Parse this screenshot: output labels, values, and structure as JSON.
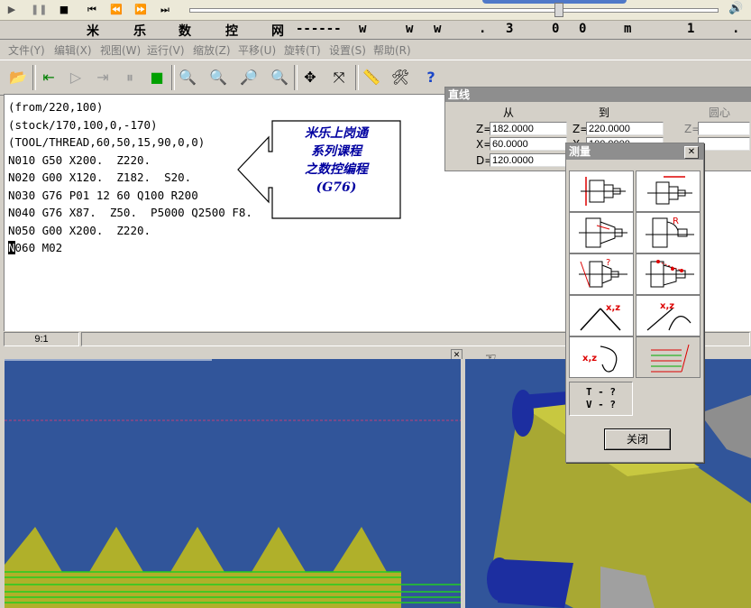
{
  "title_band": [
    "米",
    "乐",
    "数",
    "控",
    "网",
    "------",
    "w",
    "w",
    "w",
    ".",
    "3",
    "0",
    "0",
    "m",
    "1",
    "."
  ],
  "menu": [
    "文件(Y)",
    "编辑(X)",
    "视图(W)",
    "运行(V)",
    "缩放(Z)",
    "平移(U)",
    "旋转(T)",
    "设置(S)",
    "帮助(R)"
  ],
  "code_lines": [
    "(from/220,100)",
    "(stock/170,100,0,-170)",
    "(TOOL/THREAD,60,50,15,90,0,0)",
    "N010 G50 X200.  Z220.",
    "N020 G00 X120.  Z182.  S20.",
    "N030 G76 P01 12 60 Q100 R200",
    "N040 G76 X87.  Z50.  P5000 Q2500 F8.",
    "N050 G00 X200.  Z220."
  ],
  "code_last": {
    "cursor": "N",
    "rest": "060 M02"
  },
  "callout": {
    "line1": "米乐上岗通",
    "line2": "系列课程",
    "line3": "之数控编程",
    "line4": "(G76)"
  },
  "status": {
    "position": "9:1"
  },
  "line_panel": {
    "title": "直线",
    "hdr_from": "从",
    "hdr_to": "到",
    "hdr_center": "圆心",
    "z_label": "Z=",
    "x_label": "X=",
    "d_label": "D=",
    "from_z": "182.0000",
    "from_x": "60.0000",
    "from_d": "120.0000",
    "to_z": "220.0000",
    "to_x": "100.0000"
  },
  "measure_panel": {
    "title": "测量",
    "close_x": "✕",
    "tv_line1": "T - ?",
    "tv_line2": "V - ?",
    "close_button": "关闭",
    "xz": "x,z",
    "r": "R",
    "q": "?"
  },
  "colors": {
    "viewport_bg": "#31559a",
    "part_yellow": "#b0b02a",
    "thread_green": "#22cc22",
    "callout_text": "#0000a0"
  }
}
